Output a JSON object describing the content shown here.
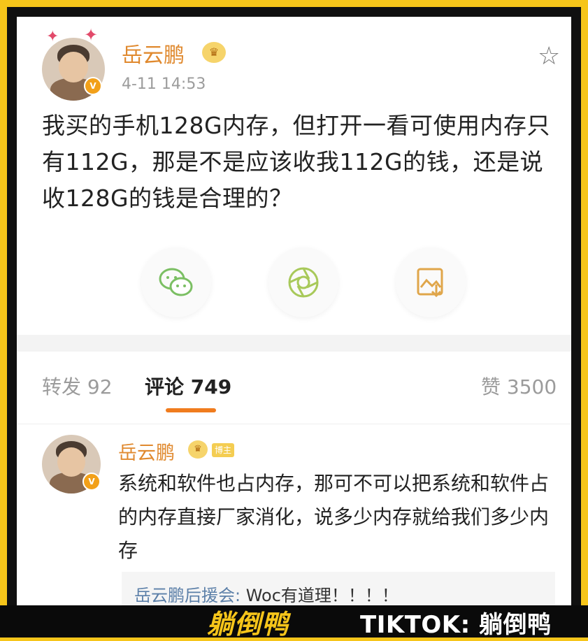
{
  "post": {
    "author": "岳云鹏",
    "crown_icon": "crown-badge-icon",
    "time": "4-11 14:53",
    "text": "我买的手机128G内存，但打开一看可使用内存只有112G，那是不是应该收我112G的钱，还是说收128G的钱是合理的？",
    "share_icons": [
      "wechat-icon",
      "moments-icon",
      "save-image-icon"
    ]
  },
  "tabs": {
    "repost": "转发 92",
    "comment": "评论 749",
    "like": "赞 3500"
  },
  "comment": {
    "author": "岳云鹏",
    "tag": "博主",
    "text": "系统和软件也占内存，那可不可以把系统和软件占的内存直接厂家消化，说多少内存就给我们多少内存",
    "reply_author": "岳云鹏后援会:",
    "reply_text": " Woc有道理！！！！"
  },
  "watermark": {
    "logo": "躺倒鸭",
    "source": "TIKTOK: 躺倒鸭"
  },
  "colors": {
    "frame": "#f6c51a",
    "name": "#e0892e",
    "accent": "#f07c1e"
  }
}
